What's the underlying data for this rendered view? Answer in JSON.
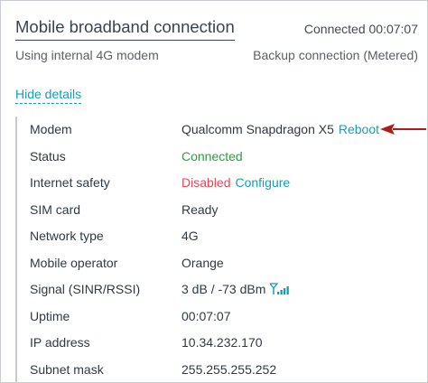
{
  "header": {
    "title": "Mobile broadband connection",
    "status": "Connected 00:07:07",
    "subtitle": "Using internal 4G modem",
    "backup": "Backup connection (Metered)"
  },
  "toggle_label": "Hide details",
  "details": {
    "modem": {
      "label": "Modem",
      "value": "Qualcomm Snapdragon X5",
      "action": "Reboot"
    },
    "status": {
      "label": "Status",
      "value": "Connected"
    },
    "internet_safety": {
      "label": "Internet safety",
      "value": "Disabled",
      "action": "Configure"
    },
    "sim_card": {
      "label": "SIM card",
      "value": "Ready"
    },
    "network_type": {
      "label": "Network type",
      "value": "4G"
    },
    "mobile_operator": {
      "label": "Mobile operator",
      "value": "Orange"
    },
    "signal": {
      "label": "Signal (SINR/RSSI)",
      "value": "3 dB / -73 dBm",
      "icon": "signal-bars-icon"
    },
    "uptime": {
      "label": "Uptime",
      "value": "00:07:07"
    },
    "ip_address": {
      "label": "IP address",
      "value": "10.34.232.170"
    },
    "subnet_mask": {
      "label": "Subnet mask",
      "value": "255.255.255.252"
    }
  },
  "colors": {
    "accent": "#1a9bb8",
    "connected": "#2e9e3e",
    "disabled": "#e0475a",
    "arrow": "#b11a1a"
  }
}
